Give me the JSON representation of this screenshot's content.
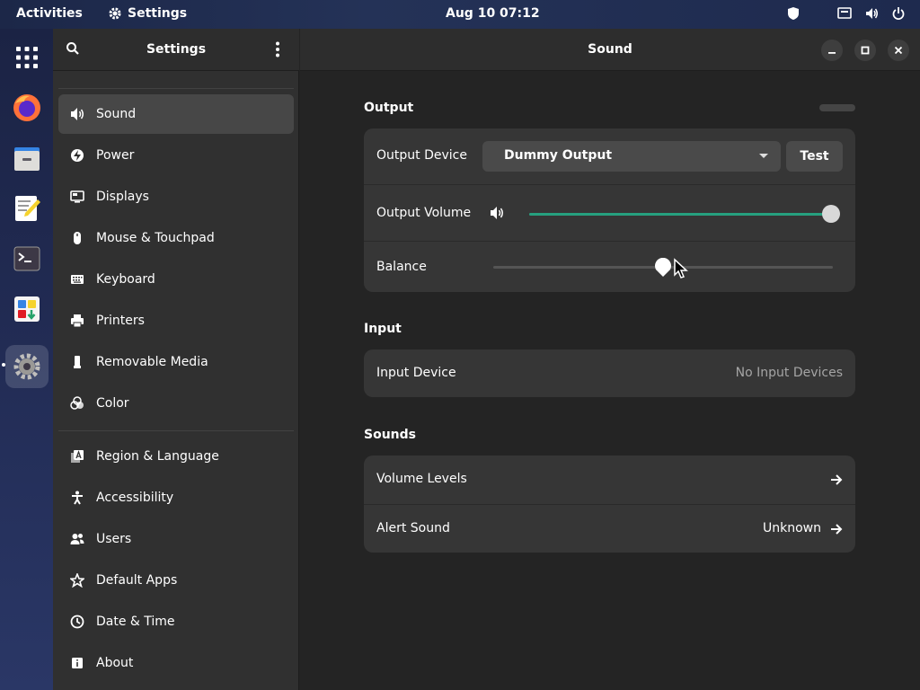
{
  "topbar": {
    "activities": "Activities",
    "app_name": "Settings",
    "clock": "Aug 10  07:12"
  },
  "sidebar": {
    "title": "Settings",
    "items_group1": [
      {
        "label": "Sound",
        "icon": "speaker-icon",
        "selected": true
      },
      {
        "label": "Power",
        "icon": "power-bolt-icon"
      },
      {
        "label": "Displays",
        "icon": "display-icon"
      },
      {
        "label": "Mouse & Touchpad",
        "icon": "mouse-icon"
      },
      {
        "label": "Keyboard",
        "icon": "keyboard-icon"
      },
      {
        "label": "Printers",
        "icon": "printer-icon"
      },
      {
        "label": "Removable Media",
        "icon": "usb-drive-icon"
      },
      {
        "label": "Color",
        "icon": "color-icon"
      }
    ],
    "items_group2": [
      {
        "label": "Region & Language",
        "icon": "region-icon"
      },
      {
        "label": "Accessibility",
        "icon": "accessibility-icon"
      },
      {
        "label": "Users",
        "icon": "users-icon"
      },
      {
        "label": "Default Apps",
        "icon": "star-icon"
      },
      {
        "label": "Date & Time",
        "icon": "clock-icon"
      },
      {
        "label": "About",
        "icon": "info-icon"
      }
    ]
  },
  "main": {
    "title": "Sound",
    "output": {
      "section_title": "Output",
      "device_label": "Output Device",
      "device_value": "Dummy Output",
      "test_label": "Test",
      "volume_label": "Output Volume",
      "volume_level": 1.0,
      "balance_label": "Balance",
      "balance_level": 0.5
    },
    "input": {
      "section_title": "Input",
      "device_label": "Input Device",
      "device_value": "No Input Devices"
    },
    "sounds": {
      "section_title": "Sounds",
      "volume_levels_label": "Volume Levels",
      "alert_label": "Alert Sound",
      "alert_value": "Unknown"
    }
  },
  "colors": {
    "accent": "#26a07f",
    "sidebar_bg": "#303030",
    "main_bg": "#242424",
    "card_bg": "#363636"
  }
}
